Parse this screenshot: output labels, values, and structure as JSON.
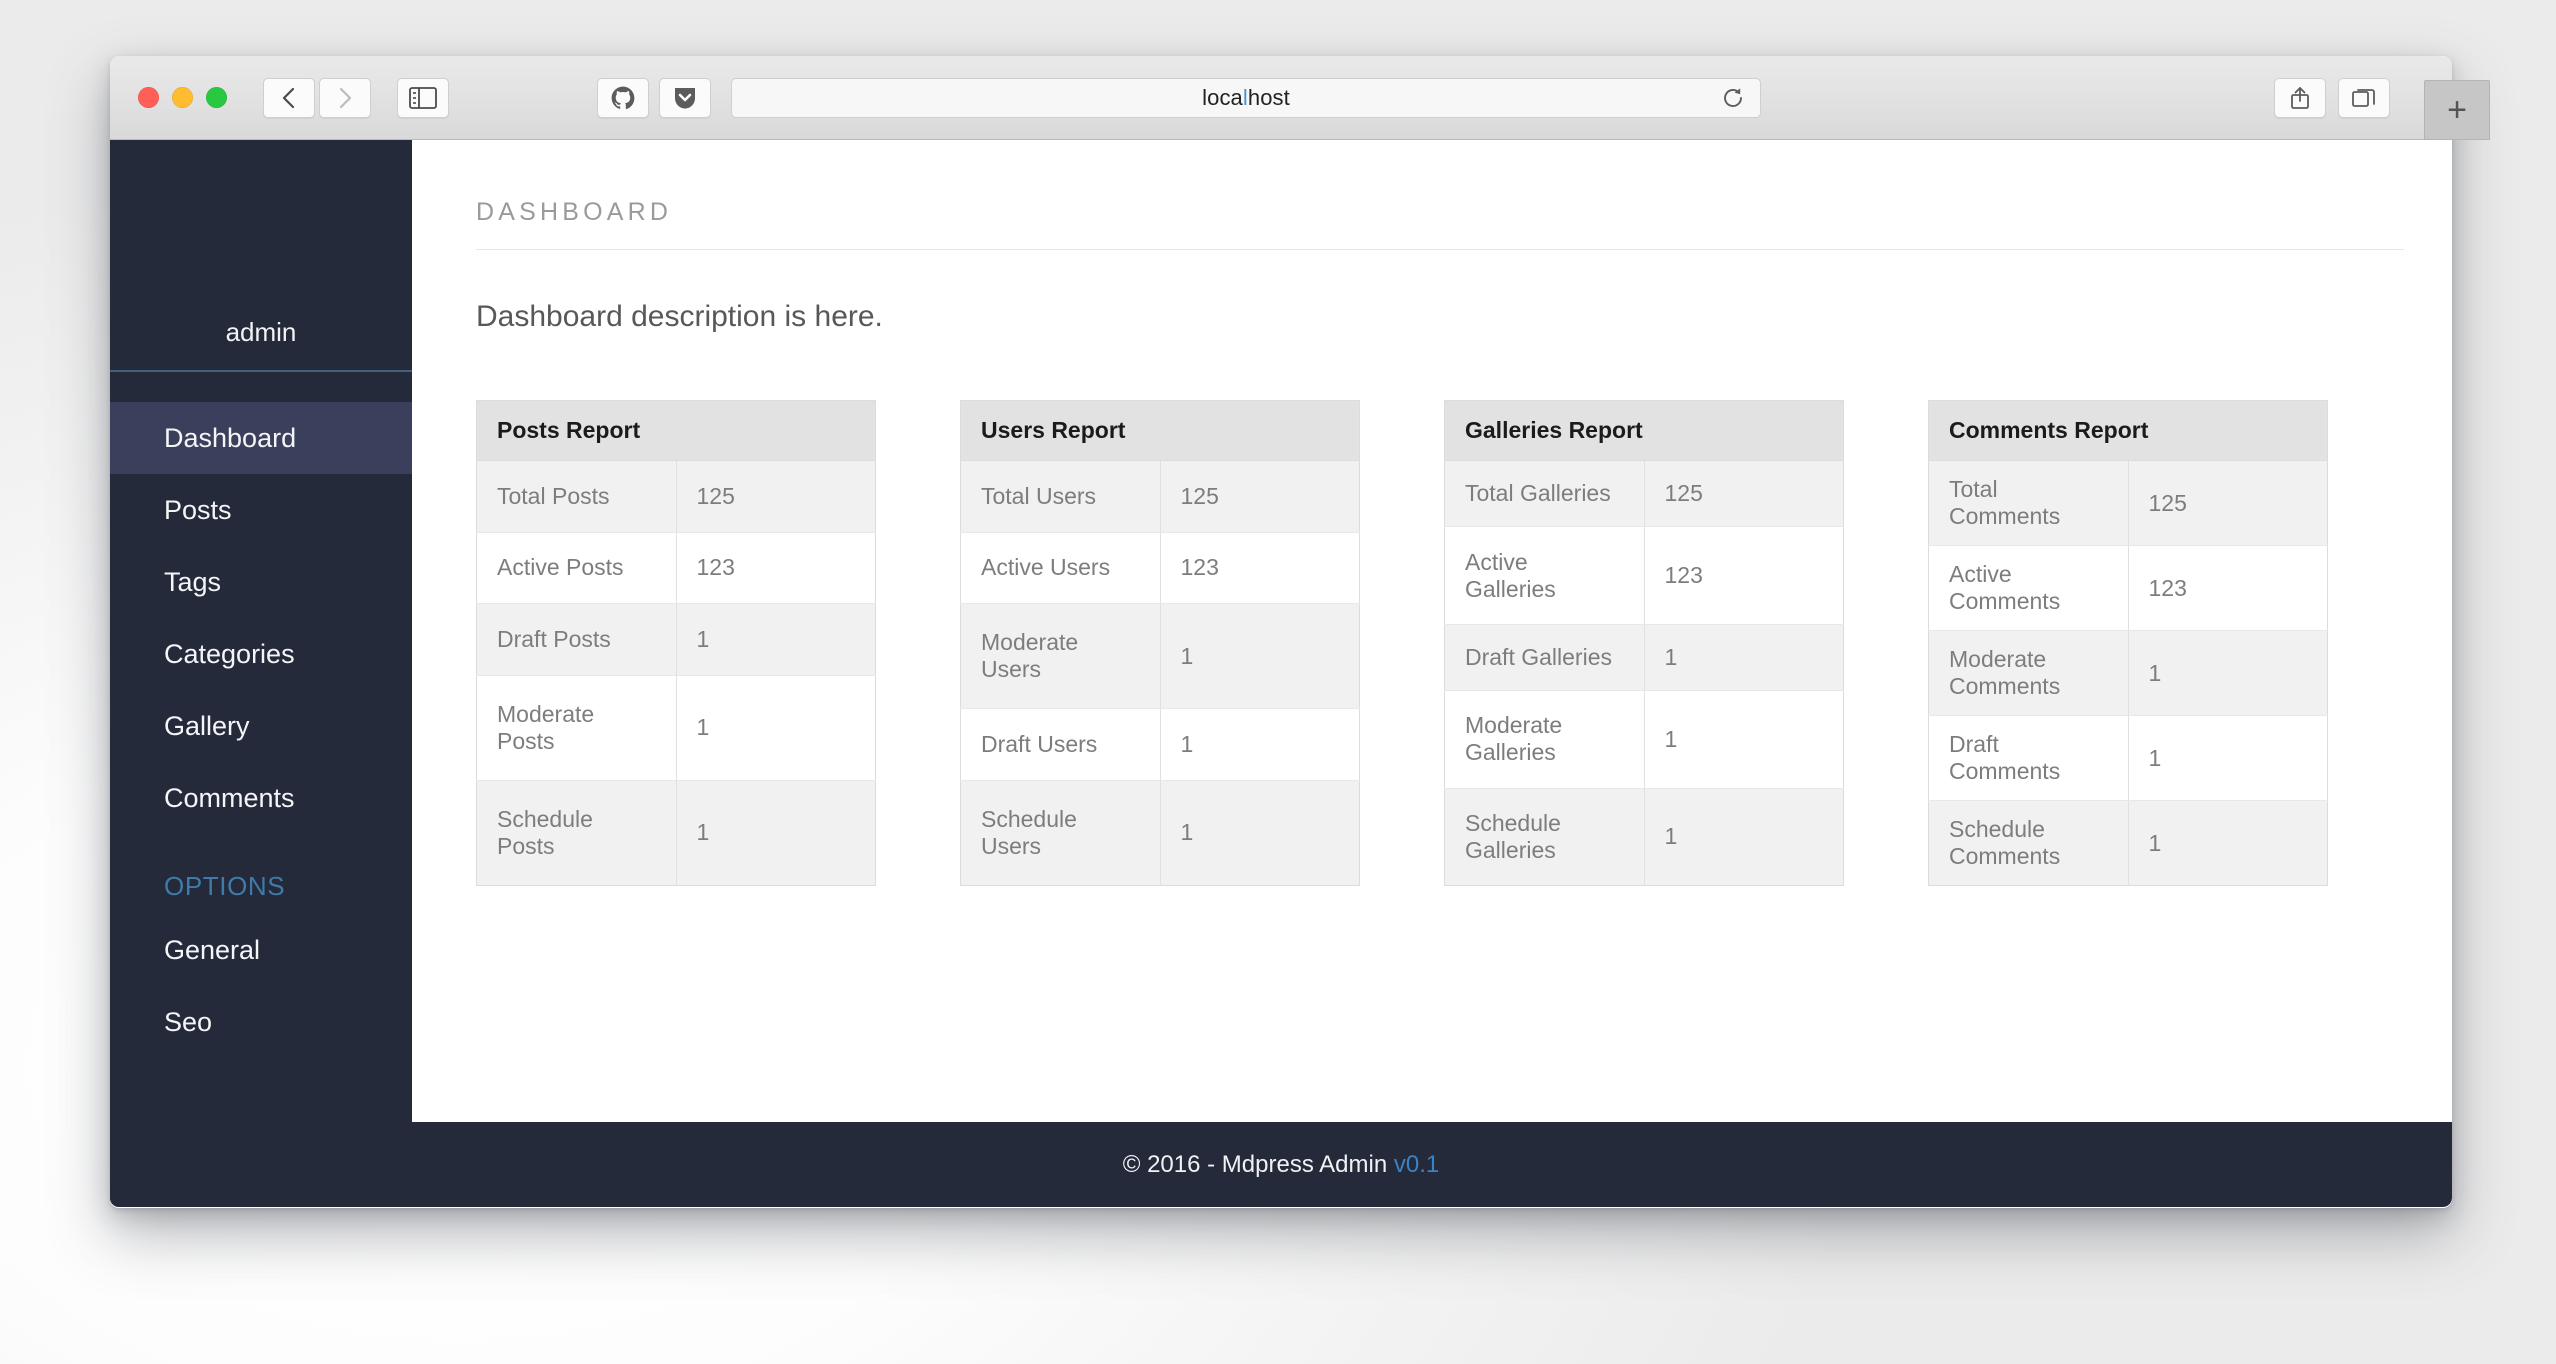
{
  "browser": {
    "address_value": "localhost",
    "address_prefix": "loca",
    "address_caret_seg": "l",
    "address_suffix": "host",
    "back_icon": "chevron-left-icon",
    "forward_icon": "chevron-right-icon",
    "sidebar_icon": "sidebar-toggle-icon",
    "github_icon": "github-icon",
    "pocket_icon": "pocket-icon",
    "reload_icon": "reload-icon",
    "share_icon": "share-icon",
    "tabs_icon": "show-all-tabs-icon",
    "new_tab_label": "+"
  },
  "sidebar": {
    "user_name": "admin",
    "items": [
      {
        "label": "Dashboard",
        "active": true
      },
      {
        "label": "Posts",
        "active": false
      },
      {
        "label": "Tags",
        "active": false
      },
      {
        "label": "Categories",
        "active": false
      },
      {
        "label": "Gallery",
        "active": false
      },
      {
        "label": "Comments",
        "active": false
      }
    ],
    "section_label": "OPTIONS",
    "option_items": [
      {
        "label": "General"
      },
      {
        "label": "Seo"
      }
    ]
  },
  "content": {
    "page_title": "DASHBOARD",
    "description": "Dashboard description is here."
  },
  "reports": [
    {
      "title": "Posts Report",
      "rows": [
        {
          "label": "Total Posts",
          "value": "125"
        },
        {
          "label": "Active Posts",
          "value": "123"
        },
        {
          "label": "Draft Posts",
          "value": "1"
        },
        {
          "label": "Moderate Posts",
          "value": "1"
        },
        {
          "label": "Schedule Posts",
          "value": "1"
        }
      ]
    },
    {
      "title": "Users Report",
      "rows": [
        {
          "label": "Total Users",
          "value": "125"
        },
        {
          "label": "Active Users",
          "value": "123"
        },
        {
          "label": "Moderate Users",
          "value": "1"
        },
        {
          "label": "Draft Users",
          "value": "1"
        },
        {
          "label": "Schedule Users",
          "value": "1"
        }
      ]
    },
    {
      "title": "Galleries Report",
      "rows": [
        {
          "label": "Total Galleries",
          "value": "125"
        },
        {
          "label": "Active Galleries",
          "value": "123"
        },
        {
          "label": "Draft Galleries",
          "value": "1"
        },
        {
          "label": "Moderate Galleries",
          "value": "1"
        },
        {
          "label": "Schedule Galleries",
          "value": "1"
        }
      ]
    },
    {
      "title": "Comments Report",
      "rows": [
        {
          "label": "Total Comments",
          "value": "125"
        },
        {
          "label": "Active Comments",
          "value": "123"
        },
        {
          "label": "Moderate Comments",
          "value": "1"
        },
        {
          "label": "Draft Comments",
          "value": "1"
        },
        {
          "label": "Schedule Comments",
          "value": "1"
        }
      ]
    }
  ],
  "footer": {
    "text": "© 2016 - Mdpress Admin",
    "version": "v0.1"
  },
  "colors": {
    "sidebar_bg": "#242a3a",
    "sidebar_active": "#3a3f5c",
    "sidebar_divider": "#44607f",
    "section_label": "#3e7ba8",
    "accent_link": "#3b82c4",
    "table_header_bg": "#e2e2e2",
    "table_stripe_bg": "#f1f1f1"
  }
}
